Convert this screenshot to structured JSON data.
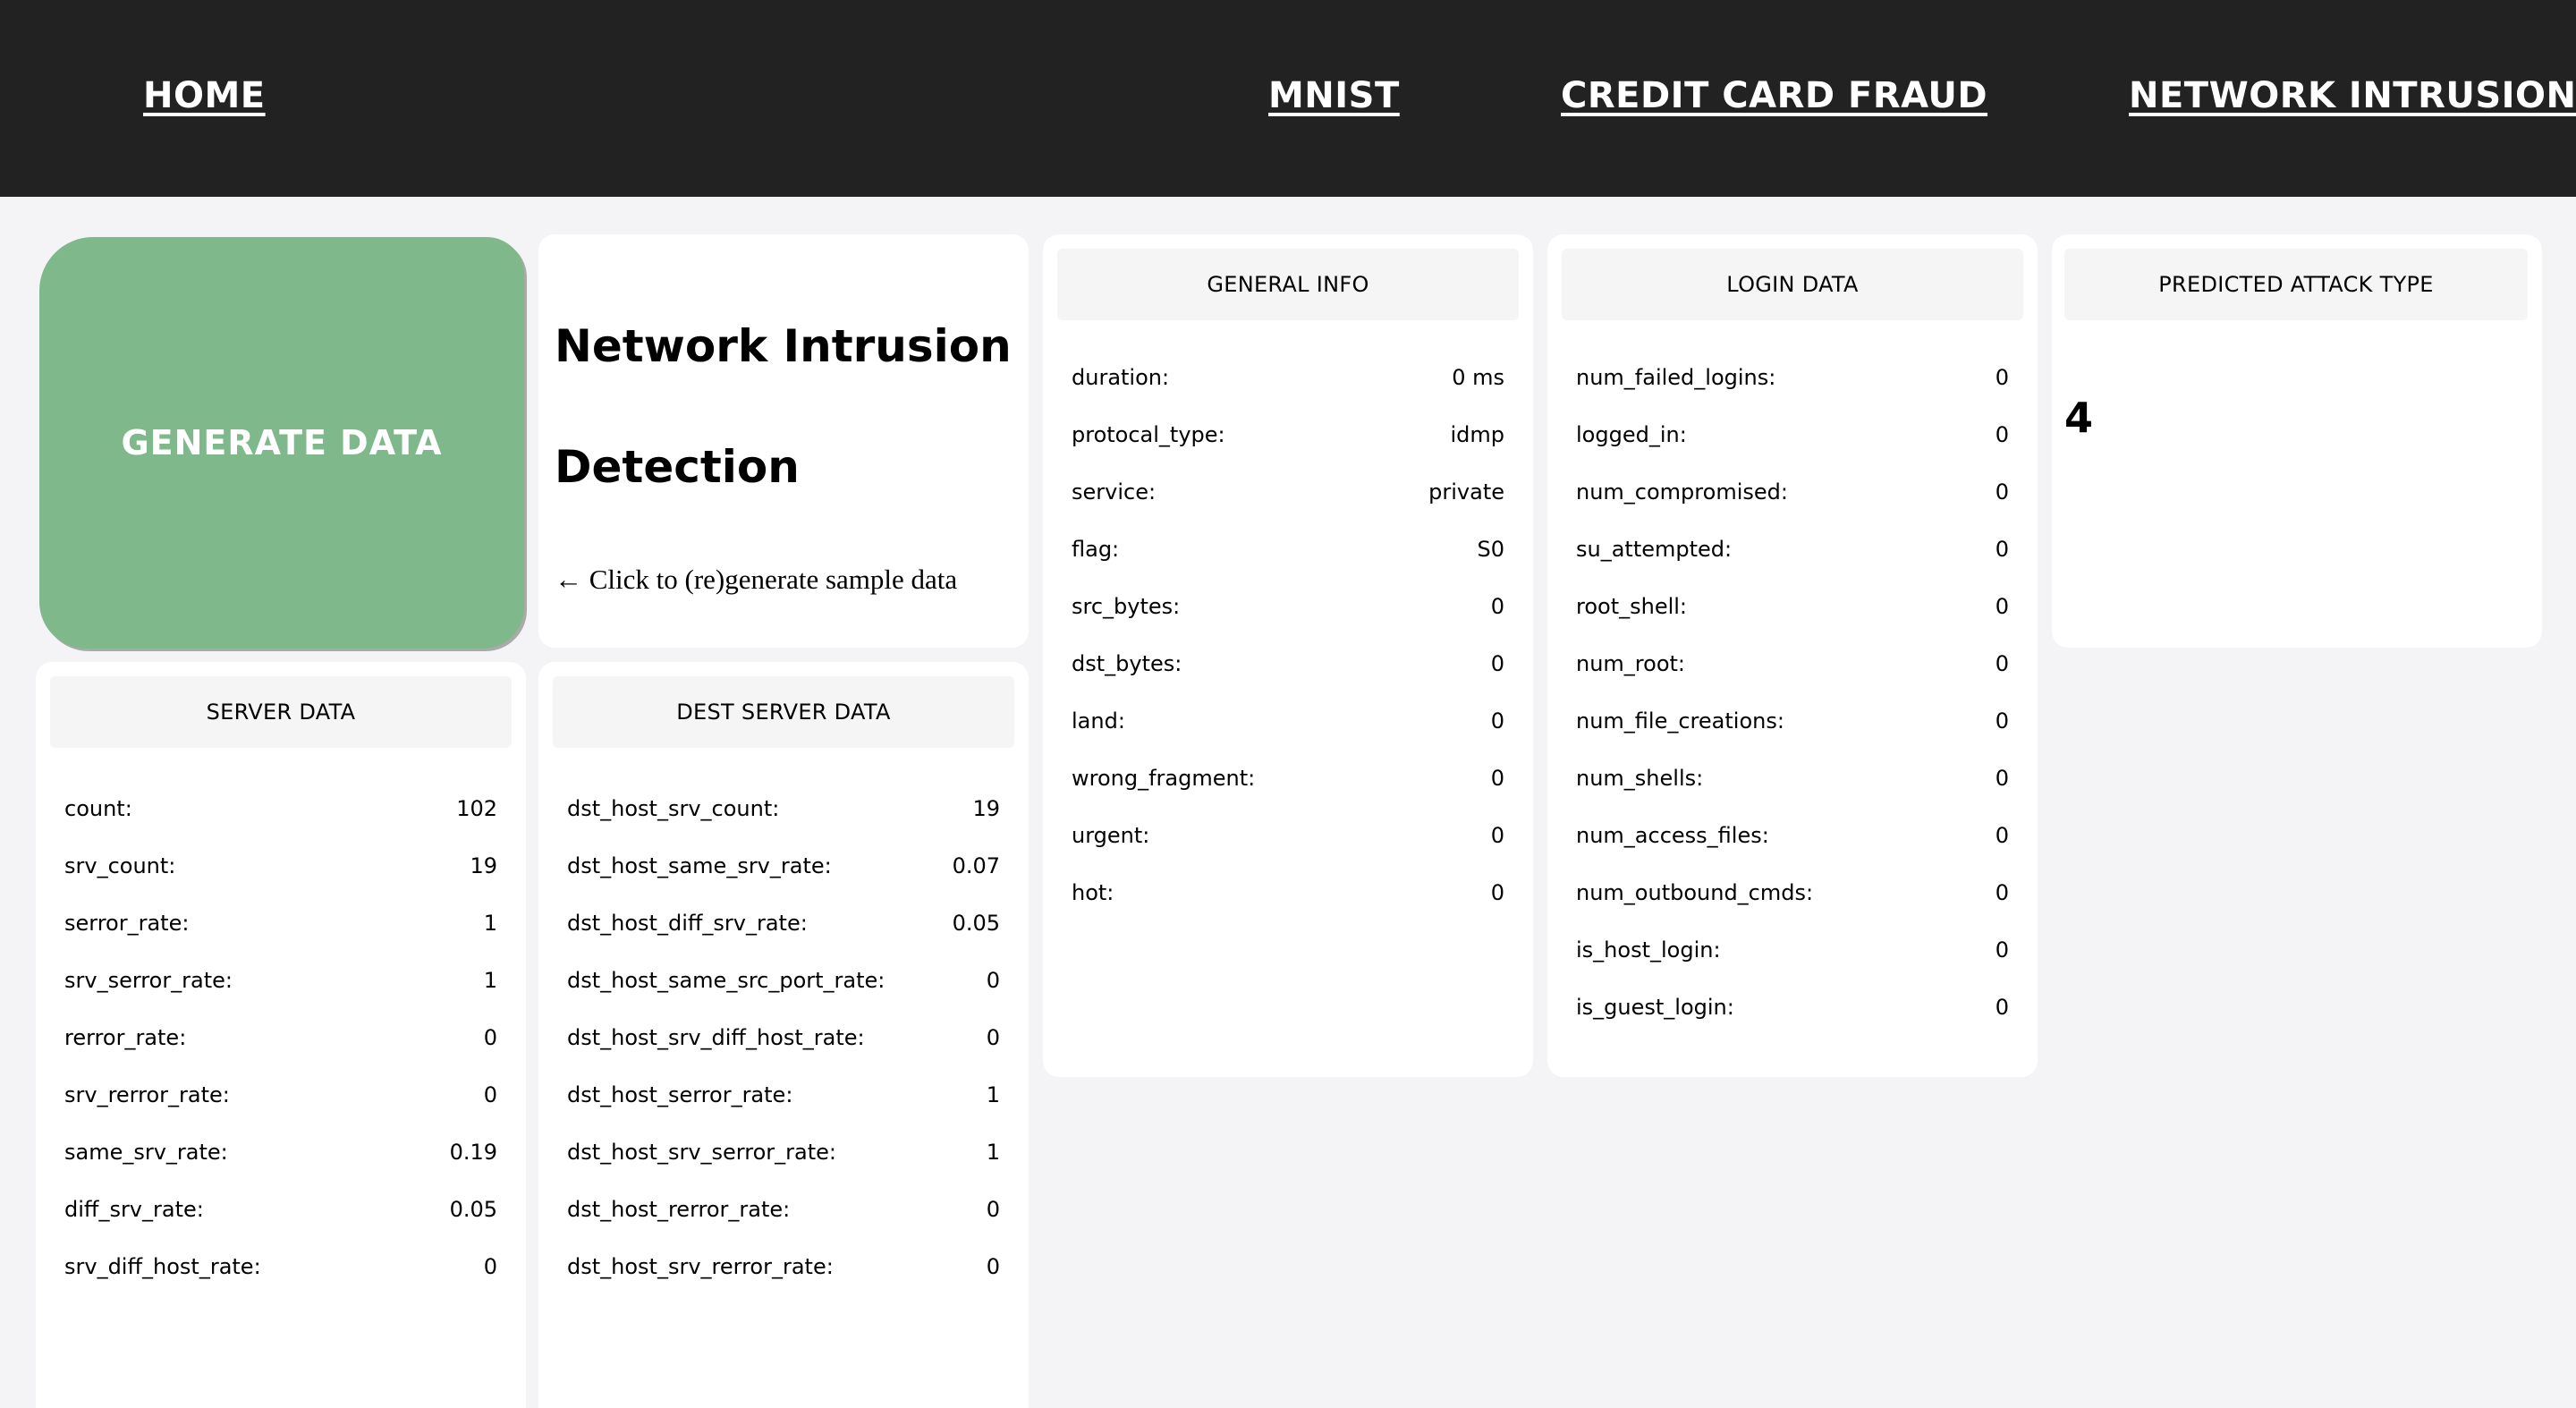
{
  "nav": {
    "home": "HOME",
    "mnist": "MNIST",
    "credit_card_fraud": "CREDIT CARD FRAUD",
    "network_intrusion": "NETWORK INTRUSION"
  },
  "generate_button": "GENERATE DATA",
  "intro": {
    "title_line1": "Network Intrusion",
    "title_line2": "Detection",
    "hint": "← Click to (re)generate sample data"
  },
  "general_info": {
    "header": "GENERAL INFO",
    "rows": [
      {
        "label": "duration:",
        "value": "0 ms"
      },
      {
        "label": "protocal_type:",
        "value": "idmp"
      },
      {
        "label": "service:",
        "value": "private"
      },
      {
        "label": "flag:",
        "value": "S0"
      },
      {
        "label": "src_bytes:",
        "value": "0"
      },
      {
        "label": "dst_bytes:",
        "value": "0"
      },
      {
        "label": "land:",
        "value": "0"
      },
      {
        "label": "wrong_fragment:",
        "value": "0"
      },
      {
        "label": "urgent:",
        "value": "0"
      },
      {
        "label": "hot:",
        "value": "0"
      }
    ]
  },
  "login_data": {
    "header": "LOGIN DATA",
    "rows": [
      {
        "label": "num_failed_logins:",
        "value": "0"
      },
      {
        "label": "logged_in:",
        "value": "0"
      },
      {
        "label": "num_compromised:",
        "value": "0"
      },
      {
        "label": "su_attempted:",
        "value": "0"
      },
      {
        "label": "root_shell:",
        "value": "0"
      },
      {
        "label": "num_root:",
        "value": "0"
      },
      {
        "label": "num_file_creations:",
        "value": "0"
      },
      {
        "label": "num_shells:",
        "value": "0"
      },
      {
        "label": "num_access_files:",
        "value": "0"
      },
      {
        "label": "num_outbound_cmds:",
        "value": "0"
      },
      {
        "label": "is_host_login:",
        "value": "0"
      },
      {
        "label": "is_guest_login:",
        "value": "0"
      }
    ]
  },
  "predicted": {
    "header": "PREDICTED ATTACK TYPE",
    "value": "4"
  },
  "server_data": {
    "header": "SERVER DATA",
    "rows": [
      {
        "label": "count:",
        "value": "102"
      },
      {
        "label": "srv_count:",
        "value": "19"
      },
      {
        "label": "serror_rate:",
        "value": "1"
      },
      {
        "label": "srv_serror_rate:",
        "value": "1"
      },
      {
        "label": "rerror_rate:",
        "value": "0"
      },
      {
        "label": "srv_rerror_rate:",
        "value": "0"
      },
      {
        "label": "same_srv_rate:",
        "value": "0.19"
      },
      {
        "label": "diff_srv_rate:",
        "value": "0.05"
      },
      {
        "label": "srv_diff_host_rate:",
        "value": "0"
      }
    ]
  },
  "dest_server_data": {
    "header": "DEST SERVER DATA",
    "rows": [
      {
        "label": "dst_host_srv_count:",
        "value": "19"
      },
      {
        "label": "dst_host_same_srv_rate:",
        "value": "0.07"
      },
      {
        "label": "dst_host_diff_srv_rate:",
        "value": "0.05"
      },
      {
        "label": "dst_host_same_src_port_rate:",
        "value": "0"
      },
      {
        "label": "dst_host_srv_diff_host_rate:",
        "value": "0"
      },
      {
        "label": "dst_host_serror_rate:",
        "value": "1"
      },
      {
        "label": "dst_host_srv_serror_rate:",
        "value": "1"
      },
      {
        "label": "dst_host_rerror_rate:",
        "value": "0"
      },
      {
        "label": "dst_host_srv_rerror_rate:",
        "value": "0"
      }
    ]
  }
}
